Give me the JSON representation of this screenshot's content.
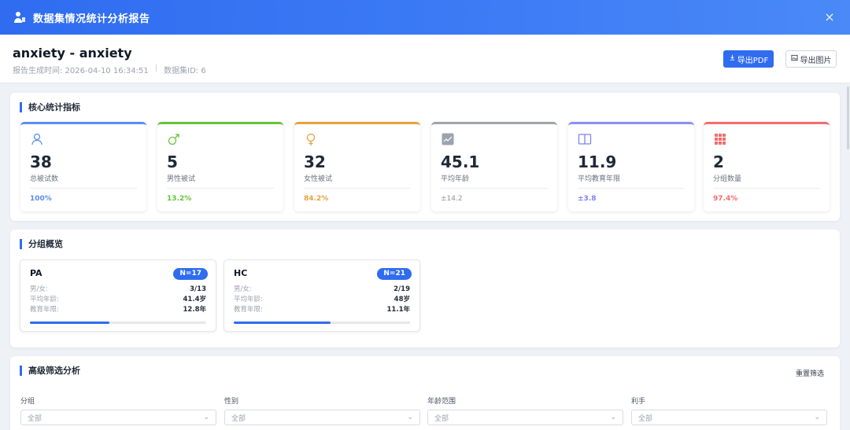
{
  "window": {
    "title": "数据集情况统计分析报告",
    "close_icon": "×"
  },
  "header": {
    "name": "anxiety - anxiety",
    "generated_time": "报告生成时间: 2026-04-10 16:34:51",
    "separator": "|",
    "dataset_id": "数据集ID: 6",
    "export_pdf": "导出PDF",
    "export_img": "导出图片"
  },
  "core": {
    "title": "核心统计指标",
    "cards": [
      {
        "icon": "user-icon",
        "value": "38",
        "label": "总被试数",
        "sub": "100%",
        "color": "#5b8def"
      },
      {
        "icon": "male-icon",
        "value": "5",
        "label": "男性被试",
        "sub": "13.2%",
        "color": "#67c23a"
      },
      {
        "icon": "female-icon",
        "value": "32",
        "label": "女性被试",
        "sub": "84.2%",
        "color": "#e6a23c"
      },
      {
        "icon": "chart-icon",
        "value": "45.1",
        "label": "平均年龄",
        "sub": "±14.2",
        "color": "#909399"
      },
      {
        "icon": "book-icon",
        "value": "11.9",
        "label": "平均教育年限",
        "sub": "±3.8",
        "color": "#7c83f3"
      },
      {
        "icon": "grid-icon",
        "value": "2",
        "label": "分组数量",
        "sub": "97.4%",
        "color": "#f56c6c"
      }
    ]
  },
  "groups": {
    "title": "分组概览",
    "items": [
      {
        "name": "PA",
        "badge": "N=17",
        "gender_label": "男/女:",
        "gender": "3/13",
        "age_label": "平均年龄:",
        "age": "41.4岁",
        "edu_label": "教育年限:",
        "edu": "12.8年",
        "progress": 0.45
      },
      {
        "name": "HC",
        "badge": "N=21",
        "gender_label": "男/女:",
        "gender": "2/19",
        "age_label": "平均年龄:",
        "age": "48岁",
        "edu_label": "教育年限:",
        "edu": "11.1年",
        "progress": 0.55
      }
    ]
  },
  "filters": {
    "title": "高级筛选分析",
    "reset": "重置筛选",
    "fields": [
      {
        "label": "分组",
        "value": "全部"
      },
      {
        "label": "性别",
        "value": "全部"
      },
      {
        "label": "年龄范围",
        "value": "全部"
      },
      {
        "label": "利手",
        "value": "全部"
      }
    ]
  }
}
